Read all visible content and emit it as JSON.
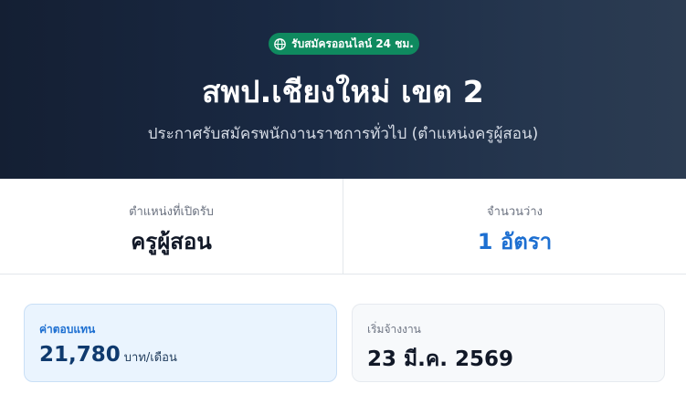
{
  "hero": {
    "badge_label": "รับสมัครออนไลน์ 24 ชม.",
    "badge_icon": "globe-icon",
    "title": "สพป.เชียงใหม่ เขต 2",
    "subtitle": "ประกาศรับสมัครพนักงานราชการทั่วไป (ตำแหน่งครูผู้สอน)"
  },
  "stats": {
    "position_label": "ตำแหน่งที่เปิดรับ",
    "position_value": "ครูผู้สอน",
    "vacancy_label": "จำนวนว่าง",
    "vacancy_value": "1 อัตรา"
  },
  "cards": {
    "salary_label": "ค่าตอบแทน",
    "salary_value": "21,780",
    "salary_unit": "บาท/เดือน",
    "start_label": "เริ่มจ้างงาน",
    "start_value": "23 มี.ค. 2569"
  },
  "colors": {
    "hero_bg": "#1a2a44",
    "badge_bg": "#0f8a5f",
    "accent_blue": "#1d6fd1"
  }
}
